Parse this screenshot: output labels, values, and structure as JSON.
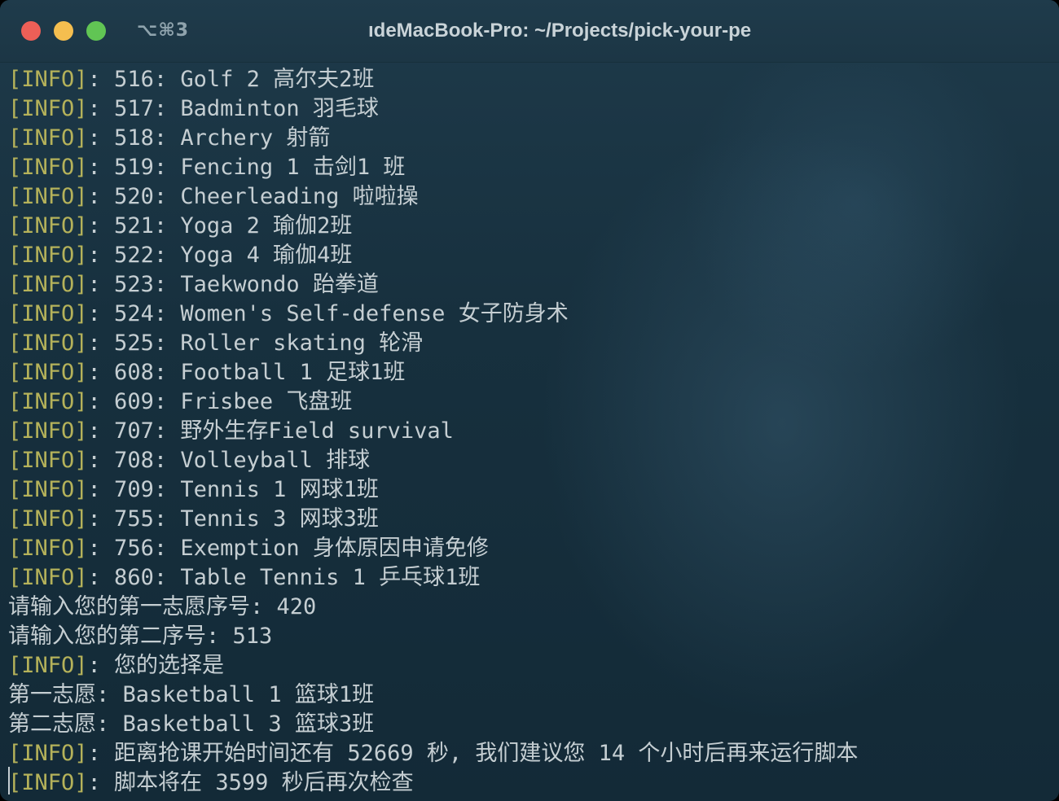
{
  "window": {
    "shortcut": "⌥⌘3",
    "title": "ıdeMacBook-Pro: ~/Projects/pick-your-pe",
    "colors": {
      "background": "#17303e",
      "text": "#c5ced2",
      "info_tag": "#b5b25a",
      "close": "#ed5f57",
      "minimize": "#f5be4f",
      "maximize": "#61c554"
    }
  },
  "terminal": {
    "lines": [
      {
        "tag": "[INFO]",
        "text": ": 516: Golf 2 高尔夫2班"
      },
      {
        "tag": "[INFO]",
        "text": ": 517: Badminton 羽毛球"
      },
      {
        "tag": "[INFO]",
        "text": ": 518: Archery 射箭"
      },
      {
        "tag": "[INFO]",
        "text": ": 519: Fencing 1 击剑1 班"
      },
      {
        "tag": "[INFO]",
        "text": ": 520: Cheerleading 啦啦操"
      },
      {
        "tag": "[INFO]",
        "text": ": 521: Yoga 2 瑜伽2班"
      },
      {
        "tag": "[INFO]",
        "text": ": 522: Yoga 4 瑜伽4班"
      },
      {
        "tag": "[INFO]",
        "text": ": 523: Taekwondo 跆拳道"
      },
      {
        "tag": "[INFO]",
        "text": ": 524: Women's Self-defense 女子防身术"
      },
      {
        "tag": "[INFO]",
        "text": ": 525: Roller skating 轮滑"
      },
      {
        "tag": "[INFO]",
        "text": ": 608: Football 1 足球1班"
      },
      {
        "tag": "[INFO]",
        "text": ": 609: Frisbee 飞盘班"
      },
      {
        "tag": "[INFO]",
        "text": ": 707: 野外生存Field survival"
      },
      {
        "tag": "[INFO]",
        "text": ": 708: Volleyball 排球"
      },
      {
        "tag": "[INFO]",
        "text": ": 709: Tennis 1 网球1班"
      },
      {
        "tag": "[INFO]",
        "text": ": 755: Tennis 3 网球3班"
      },
      {
        "tag": "[INFO]",
        "text": ": 756: Exemption 身体原因申请免修"
      },
      {
        "tag": "[INFO]",
        "text": ": 860: Table Tennis 1 乒乓球1班"
      },
      {
        "tag": "",
        "text": "请输入您的第一志愿序号: 420"
      },
      {
        "tag": "",
        "text": "请输入您的第二序号: 513"
      },
      {
        "tag": "[INFO]",
        "text": ": 您的选择是"
      },
      {
        "tag": "",
        "text": "第一志愿: Basketball 1 篮球1班"
      },
      {
        "tag": "",
        "text": "第二志愿: Basketball 3 篮球3班"
      },
      {
        "tag": "[INFO]",
        "text": ": 距离抢课开始时间还有 52669 秒, 我们建议您 14 个小时后再来运行脚本"
      },
      {
        "tag": "[INFO]",
        "text": ": 脚本将在 3599 秒后再次检查"
      }
    ]
  }
}
